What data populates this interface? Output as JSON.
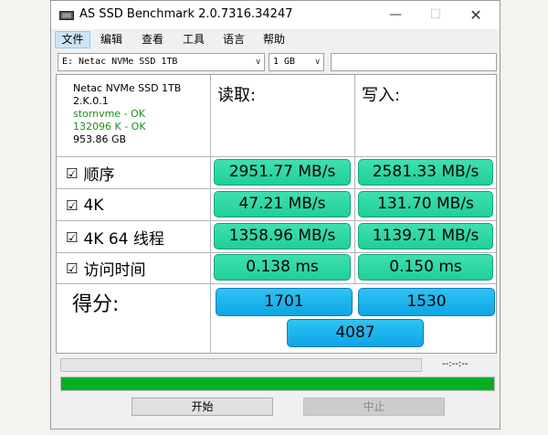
{
  "window": {
    "title": "AS SSD Benchmark 2.0.7316.34247"
  },
  "menu": [
    "文件",
    "编辑",
    "查看",
    "工具",
    "语言",
    "帮助"
  ],
  "toolbar": {
    "drive_select": "E: Netac NVMe SSD 1TB",
    "size_select": "1 GB",
    "extra_field": ""
  },
  "info": {
    "model": "Netac NVMe SSD 1TB",
    "firmware": "2.K.0.1",
    "driver": "stornvme - OK",
    "alignment": "132096 K - OK",
    "capacity": "953.86 GB"
  },
  "headers": {
    "read": "读取:",
    "write": "写入:"
  },
  "rows": [
    {
      "label": "顺序",
      "read": "2951.77 MB/s",
      "write": "2581.33 MB/s"
    },
    {
      "label": "4K",
      "read": "47.21 MB/s",
      "write": "131.70 MB/s"
    },
    {
      "label": "4K 64 线程",
      "read": "1358.96 MB/s",
      "write": "1139.71 MB/s"
    },
    {
      "label": "访问时间",
      "read": "0.138 ms",
      "write": "0.150 ms"
    }
  ],
  "score": {
    "label": "得分:",
    "read": "1701",
    "write": "1530",
    "total": "4087"
  },
  "status": {
    "time": "--:--:--",
    "progress_fraction": 1.0
  },
  "buttons": {
    "start": "开始",
    "stop": "中止"
  },
  "colors": {
    "result": "#2cd8a6",
    "score": "#1cb4ee",
    "progress": "#06b025"
  }
}
